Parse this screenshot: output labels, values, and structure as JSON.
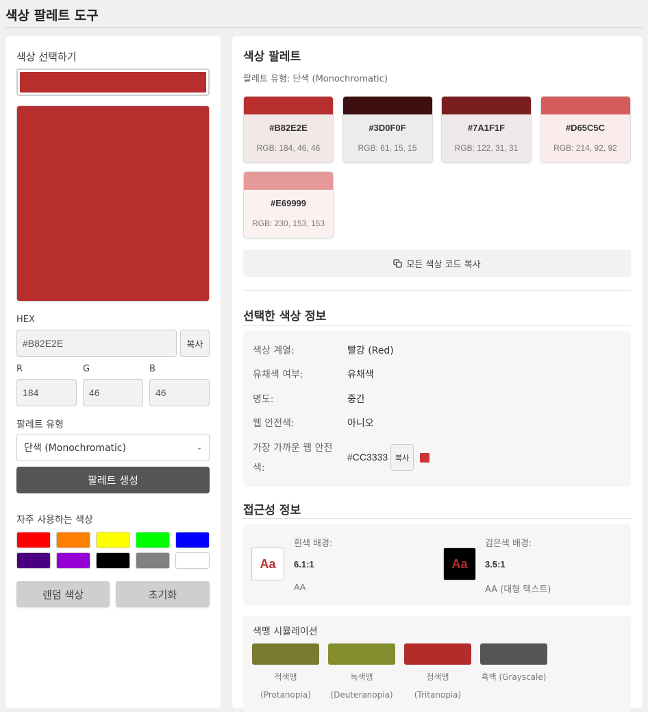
{
  "app": {
    "title": "색상 팔레트 도구"
  },
  "picker": {
    "heading": "색상 선택하기",
    "selected_color": "#B82E2E",
    "hex_label": "HEX",
    "hex_value": "#B82E2E",
    "copy_label": "복사",
    "r_label": "R",
    "g_label": "G",
    "b_label": "B",
    "r_value": "184",
    "g_value": "46",
    "b_value": "46",
    "palette_type_label": "팔레트 유형",
    "palette_type_selected": "단색 (Monochromatic)",
    "generate_label": "팔레트 생성",
    "favorites_label": "자주 사용하는 색상",
    "favorites": [
      "#FF0000",
      "#FF8000",
      "#FFFF00",
      "#00FF00",
      "#0000FF",
      "#4B0082",
      "#9400D3",
      "#000000",
      "#808080",
      "#FFFFFF"
    ],
    "random_label": "랜덤 색상",
    "reset_label": "초기화"
  },
  "palette": {
    "title": "색상 팔레트",
    "type_text": "팔레트 유형: 단색 (Monochromatic)",
    "colors": [
      {
        "hex": "#B82E2E",
        "rgb": "RGB: 184, 46, 46",
        "bg": "#F2E8E8"
      },
      {
        "hex": "#3D0F0F",
        "rgb": "RGB: 61, 15, 15",
        "bg": "#EEEBEB"
      },
      {
        "hex": "#7A1F1F",
        "rgb": "RGB: 122, 31, 31",
        "bg": "#F0E9E9"
      },
      {
        "hex": "#D65C5C",
        "rgb": "RGB: 214, 92, 92",
        "bg": "#FBECEC"
      },
      {
        "hex": "#E69999",
        "rgb": "RGB: 230, 153, 153",
        "bg": "#FCF1F1"
      }
    ],
    "copy_all_label": "모든 색상 코드 복사"
  },
  "info": {
    "title": "선택한 색상 정보",
    "family_label": "색상 계열:",
    "family_value": "빨강 (Red)",
    "chromatic_label": "유채색 여부:",
    "chromatic_value": "유채색",
    "brightness_label": "명도:",
    "brightness_value": "중간",
    "websafe_label": "웹 안전색:",
    "websafe_value": "아니오",
    "nearest_label_1": "가장 가까운 웹 안전",
    "nearest_label_2": "색:",
    "nearest_value": "#CC3333",
    "nearest_color": "#CC3333",
    "copy_label": "복사"
  },
  "accessibility": {
    "title": "접근성 정보",
    "sample": "Aa",
    "white_label": "흰색 배경:",
    "white_ratio": "6.1:1",
    "white_level": "AA",
    "black_label": "검은색 배경:",
    "black_ratio": "3.5:1",
    "black_level": "AA (대형 텍스트)"
  },
  "colorblind": {
    "title": "색맹 시뮬레이션",
    "items": [
      {
        "color": "#7A7A30",
        "name": "적색맹",
        "sub": "(Protanopia)"
      },
      {
        "color": "#858E2E",
        "name": "녹색맹",
        "sub": "(Deuteranopia)"
      },
      {
        "color": "#B32B2B",
        "name": "청색맹",
        "sub": "(Tritanopia)"
      },
      {
        "color": "#555555",
        "name": "흑백 (Grayscale)",
        "sub": ""
      }
    ]
  }
}
